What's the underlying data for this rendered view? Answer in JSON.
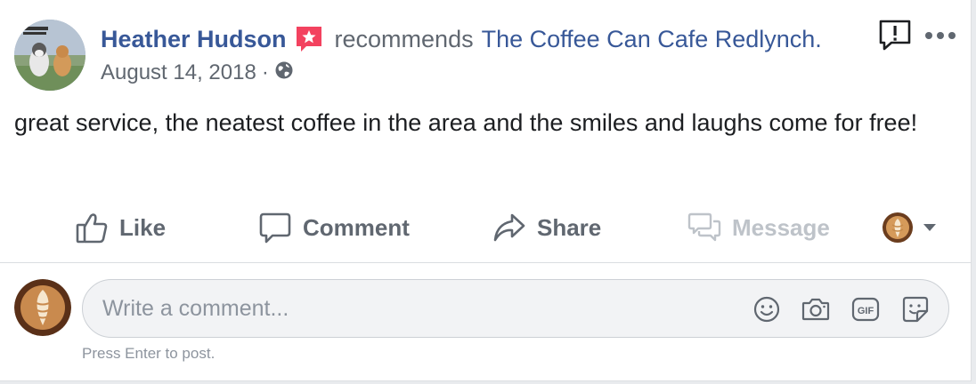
{
  "post": {
    "author": "Heather Hudson",
    "action_text": "recommends",
    "page_name": "The Coffee Can Cafe Redlynch.",
    "date": "August 14, 2018",
    "separator": "·",
    "privacy_icon": "globe-icon",
    "body": "great service, the neatest coffee in the area and the smiles and laughs come for free!"
  },
  "actions": {
    "like": "Like",
    "comment": "Comment",
    "share": "Share",
    "message": "Message"
  },
  "composer": {
    "placeholder": "Write a comment...",
    "hint": "Press Enter to post.",
    "icons": [
      "emoji-icon",
      "camera-icon",
      "gif-icon",
      "sticker-icon"
    ]
  },
  "colors": {
    "link": "#385898",
    "recommend_badge": "#f3425f",
    "secondary_text": "#606770",
    "disabled_text": "#bec3c9"
  }
}
